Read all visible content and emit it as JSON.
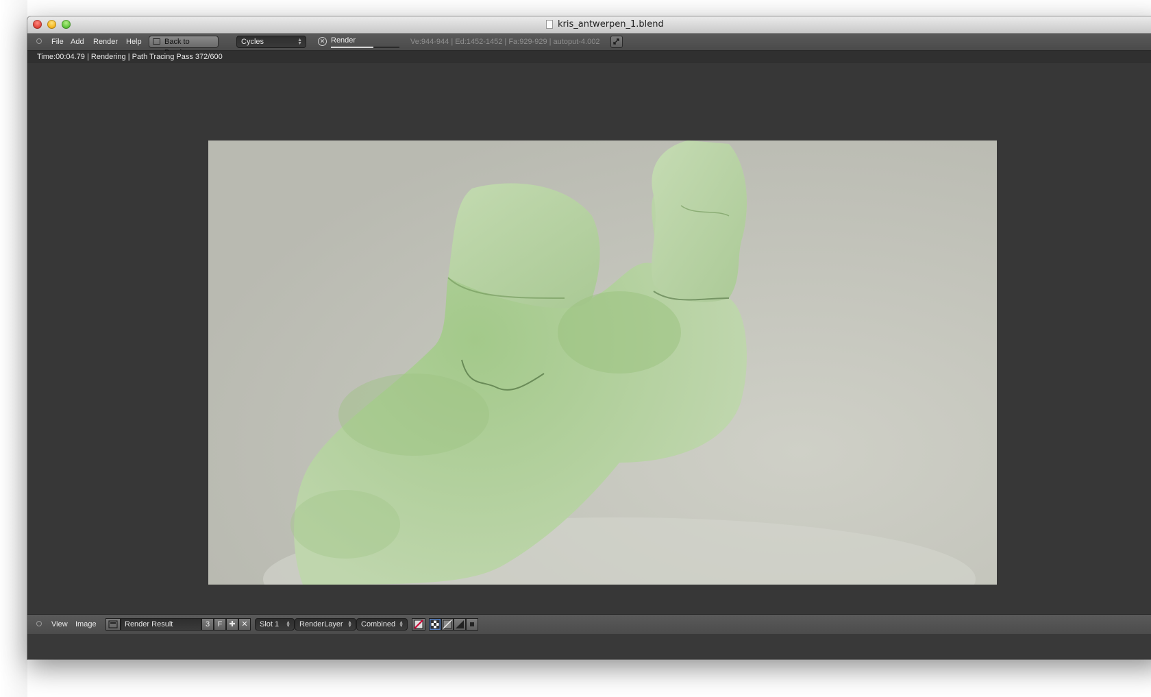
{
  "window": {
    "title": "kris_antwerpen_1.blend"
  },
  "header": {
    "menus": [
      "File",
      "Add",
      "Render",
      "Help"
    ],
    "back_button_label": "Back to Previous",
    "engine_selector": "Cycles",
    "render_label": "Render",
    "render_progress": 0.62,
    "stats": "Ve:944-944 | Ed:1452-1452 | Fa:929-929 | autoput-4.002"
  },
  "info": {
    "status": "Time:00:04.79 | Rendering | Path Tracing Pass 372/600"
  },
  "footer": {
    "menus": [
      "View",
      "Image"
    ],
    "image_name": "Render Result",
    "users_count": "3",
    "fake_user": "F",
    "slot": "Slot 1",
    "render_layer": "RenderLayer",
    "pass": "Combined"
  },
  "colors": {
    "viewport_bg": "#373737",
    "render_bg": "#c3c4bb",
    "sculpture_green": "#b6d2a0"
  }
}
